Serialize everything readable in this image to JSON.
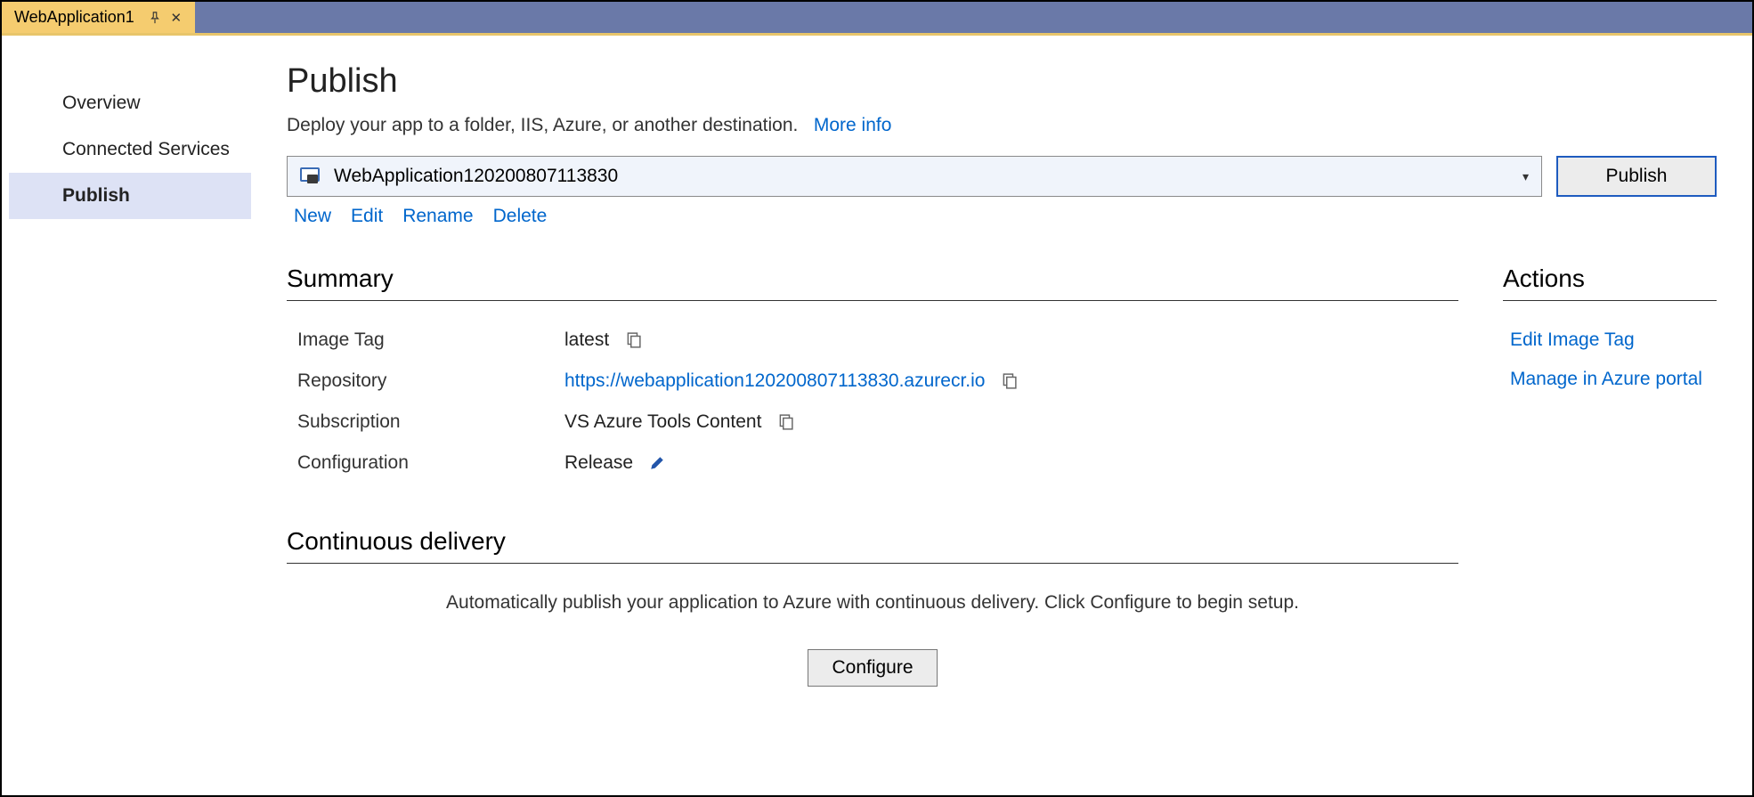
{
  "tab": {
    "title": "WebApplication1"
  },
  "sidebar": {
    "items": [
      {
        "label": "Overview"
      },
      {
        "label": "Connected Services"
      },
      {
        "label": "Publish"
      }
    ],
    "active_index": 2
  },
  "page": {
    "title": "Publish",
    "subtitle": "Deploy your app to a folder, IIS, Azure, or another destination.",
    "more_info": "More info"
  },
  "profile": {
    "selected": "WebApplication120200807113830",
    "publish_button": "Publish",
    "actions": [
      "New",
      "Edit",
      "Rename",
      "Delete"
    ]
  },
  "summary": {
    "header": "Summary",
    "rows": [
      {
        "label": "Image Tag",
        "value": "latest",
        "copy": true
      },
      {
        "label": "Repository",
        "value": "https://webapplication120200807113830.azurecr.io",
        "link": true,
        "copy": true
      },
      {
        "label": "Subscription",
        "value": "VS Azure Tools Content",
        "copy": true
      },
      {
        "label": "Configuration",
        "value": "Release",
        "edit": true
      }
    ]
  },
  "actions": {
    "header": "Actions",
    "items": [
      "Edit Image Tag",
      "Manage in Azure portal"
    ]
  },
  "continuous_delivery": {
    "header": "Continuous delivery",
    "description": "Automatically publish your application to Azure with continuous delivery. Click Configure to begin setup.",
    "configure_button": "Configure"
  }
}
